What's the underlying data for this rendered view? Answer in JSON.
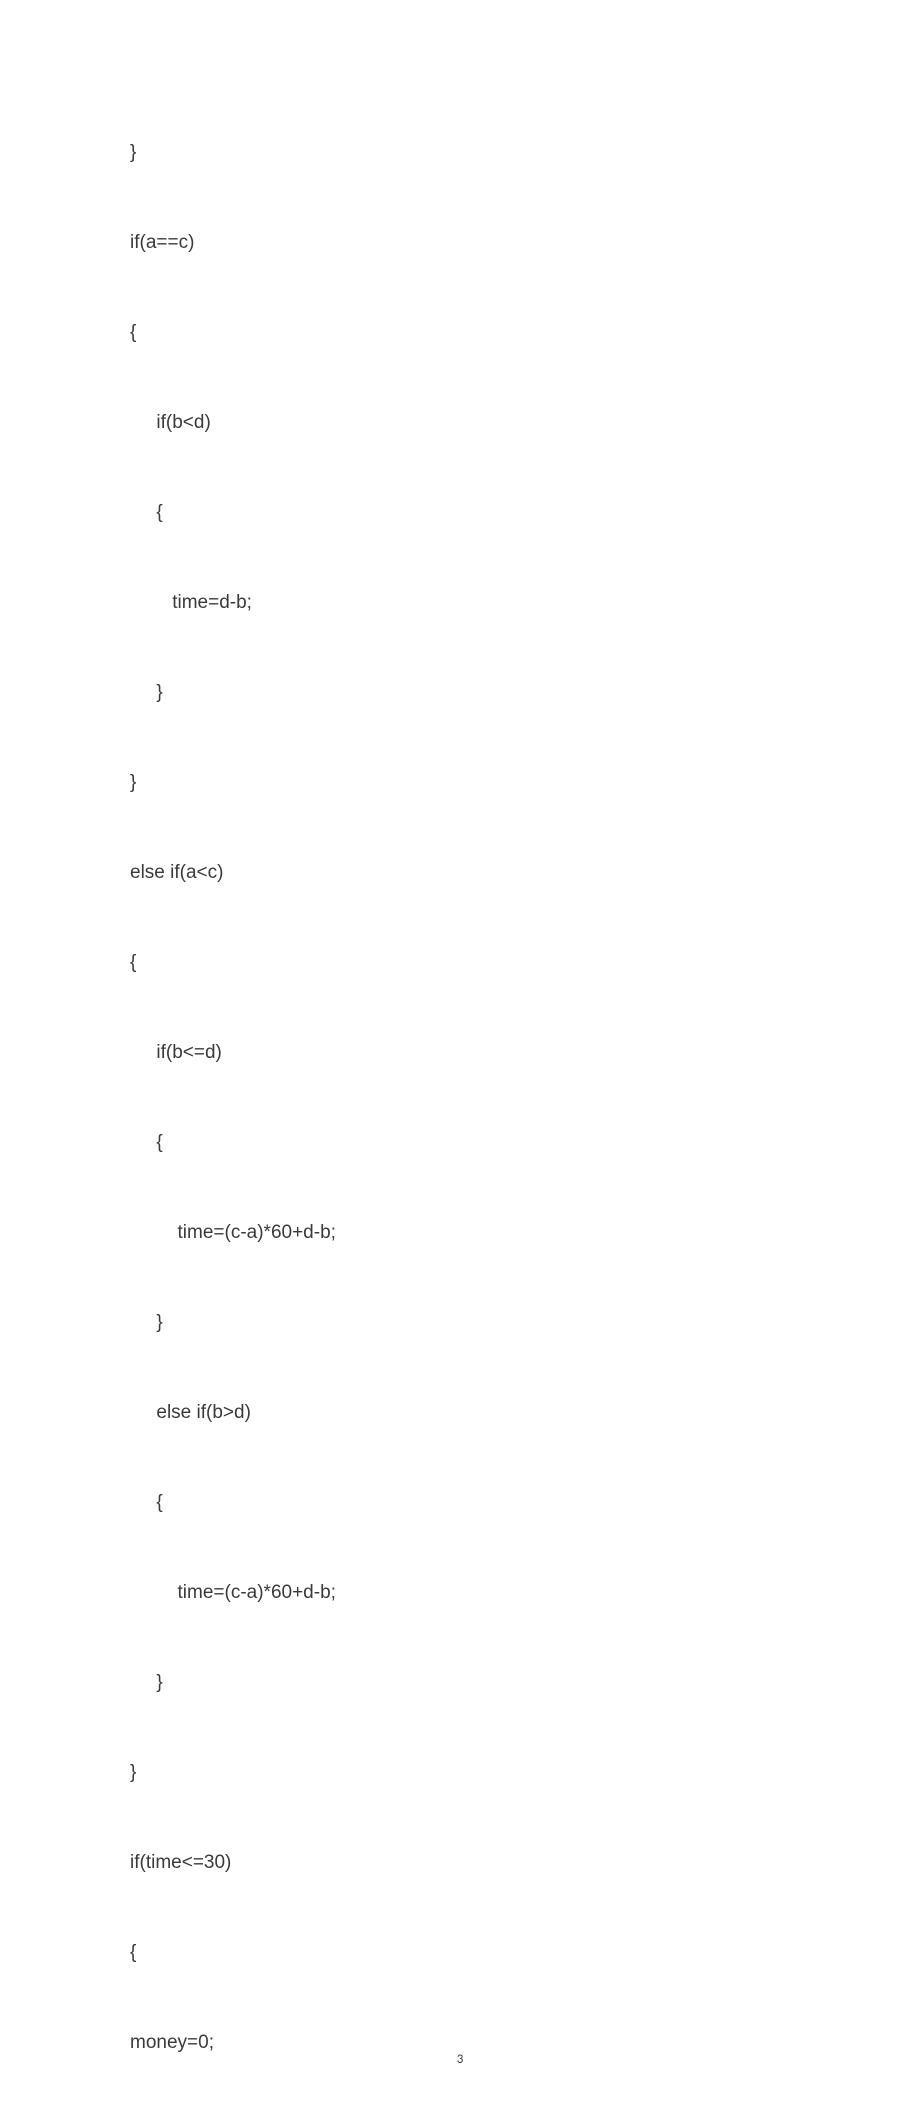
{
  "code_lines": [
    "}",
    "if(a==c)",
    "{",
    "     if(b<d)",
    "     {",
    "        time=d-b;",
    "     }",
    "}",
    "else if(a<c)",
    "{",
    "     if(b<=d)",
    "     {",
    "         time=(c-a)*60+d-b;",
    "     }",
    "     else if(b>d)",
    "     {",
    "         time=(c-a)*60+d-b;",
    "     }",
    "}",
    "if(time<=30)",
    "{",
    "money=0;"
  ],
  "page_number": "3"
}
